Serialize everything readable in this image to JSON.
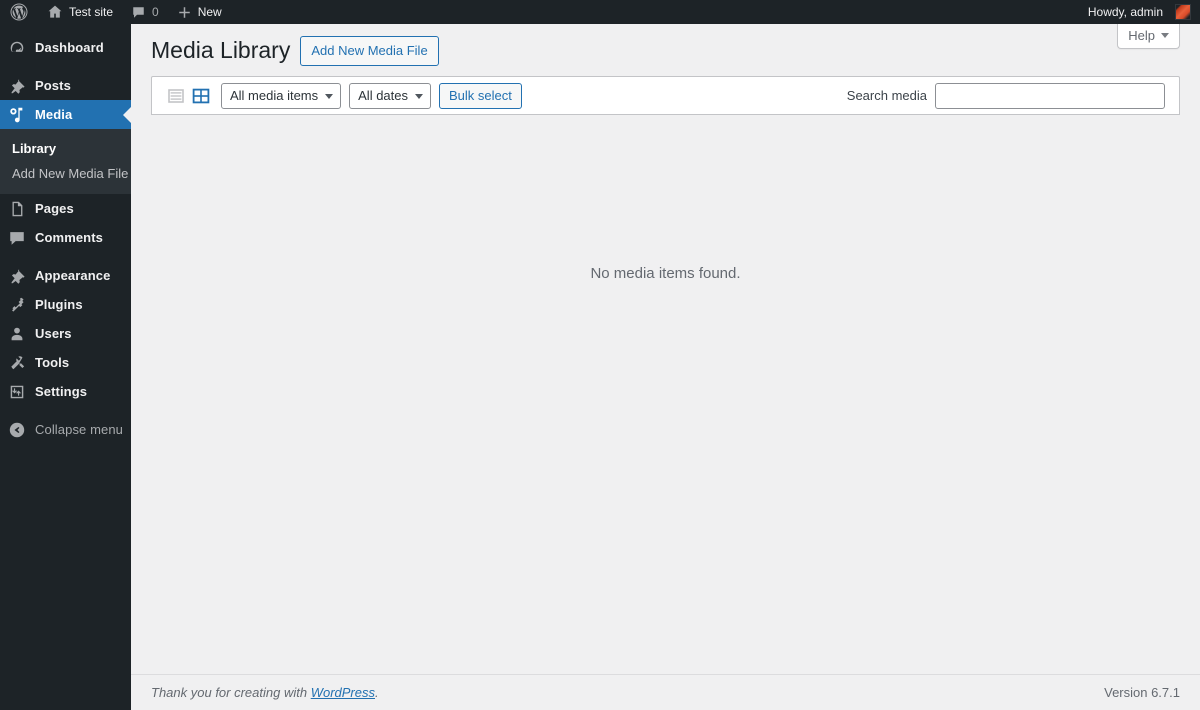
{
  "adminbar": {
    "wp_logo_icon": "wordpress-logo-icon",
    "site": {
      "icon": "home-icon",
      "label": "Test site"
    },
    "comments": {
      "icon": "comment-bubble-icon",
      "count": "0"
    },
    "new": {
      "icon": "plus-icon",
      "label": "New"
    },
    "account": {
      "greeting": "Howdy, admin",
      "avatar": "user-avatar"
    }
  },
  "sidebar": {
    "items": [
      {
        "label": "Dashboard",
        "icon": "dashboard-icon",
        "name": "dashboard"
      },
      {
        "label": "Posts",
        "icon": "pin-icon",
        "name": "posts"
      },
      {
        "label": "Media",
        "icon": "media-icon",
        "name": "media",
        "current": true
      },
      {
        "label": "Pages",
        "icon": "page-icon",
        "name": "pages"
      },
      {
        "label": "Comments",
        "icon": "comment-bubble-icon",
        "name": "comments"
      },
      {
        "label": "Appearance",
        "icon": "paintbrush-icon",
        "name": "appearance"
      },
      {
        "label": "Plugins",
        "icon": "plug-icon",
        "name": "plugins"
      },
      {
        "label": "Users",
        "icon": "user-icon",
        "name": "users"
      },
      {
        "label": "Tools",
        "icon": "wrench-icon",
        "name": "tools"
      },
      {
        "label": "Settings",
        "icon": "settings-sliders-icon",
        "name": "settings"
      }
    ],
    "submenu": [
      {
        "label": "Library",
        "current": true
      },
      {
        "label": "Add New Media File",
        "current": false
      }
    ],
    "collapse": {
      "label": "Collapse menu",
      "icon": "collapse-arrow-icon"
    }
  },
  "screen_meta": {
    "help_label": "Help",
    "help_caret": "chevron-down-icon"
  },
  "header": {
    "title": "Media Library",
    "add_new_label": "Add New Media File"
  },
  "toolbar": {
    "view_list_icon": "list-view-icon",
    "view_grid_icon": "grid-view-icon",
    "active_view": "grid",
    "filter_media": "All media items",
    "filter_dates": "All dates",
    "bulk_select_label": "Bulk select",
    "search_label": "Search media",
    "search_value": "",
    "search_placeholder": ""
  },
  "content": {
    "empty_message": "No media items found."
  },
  "footer": {
    "thanks_prefix": "Thank you for creating with ",
    "wordpress_link": "WordPress",
    "thanks_suffix": ".",
    "version": "Version 6.7.1"
  },
  "colors": {
    "admin_dark": "#1d2327",
    "submenu_dark": "#2c3338",
    "accent_blue": "#2271b1",
    "page_bg": "#f0f0f1",
    "muted_text": "#646970"
  }
}
